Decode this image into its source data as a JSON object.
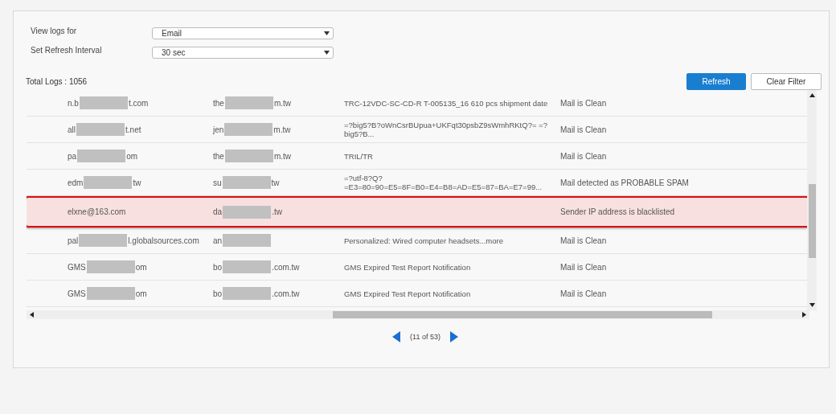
{
  "filters": [
    {
      "label": "View logs for",
      "value": "Email"
    },
    {
      "label": "Set Refresh Interval",
      "value": "30 sec"
    }
  ],
  "total_logs": "Total Logs : 1056",
  "buttons": [
    {
      "label": "Refresh",
      "kind": "primary"
    },
    {
      "label": "Clear Filter",
      "kind": "secondary"
    }
  ],
  "table": {
    "rows": [
      {
        "selected": false,
        "from": {
          "kind": "redacted",
          "start": "n.b",
          "end": "t.com"
        },
        "to": {
          "kind": "redacted",
          "start": "the",
          "end": "m.tw"
        },
        "subject": "TRC-12VDC-SC-CD-R T-005135_16 610 pcs shipment date",
        "status": "Mail is Clean"
      },
      {
        "selected": false,
        "from": {
          "kind": "redacted",
          "start": "all",
          "end": "t.net"
        },
        "to": {
          "kind": "redacted",
          "start": "jen",
          "end": "m.tw"
        },
        "subject": "=?big5?B?oWnCsrBUpua+UKFqt30psbZ9sWmhRKtQ?= =?big5?B...",
        "status": "Mail is Clean"
      },
      {
        "selected": false,
        "from": {
          "kind": "redacted",
          "start": "pa",
          "end": "om"
        },
        "to": {
          "kind": "redacted",
          "start": "the",
          "end": "m.tw"
        },
        "subject": "TRIL/TR",
        "status": "Mail is Clean"
      },
      {
        "selected": false,
        "from": {
          "kind": "redacted",
          "start": "edm",
          "end": "tw"
        },
        "to": {
          "kind": "redacted",
          "start": "su",
          "end": "tw"
        },
        "subject": "=?utf-8?Q? =E3=80=90=E5=8F=B0=E4=B8=AD=E5=87=BA=E7=99...",
        "status": "Mail detected as PROBABLE SPAM"
      },
      {
        "selected": true,
        "from": {
          "kind": "plain",
          "start": "elxne@163.com"
        },
        "to": {
          "kind": "redacted",
          "start": "da",
          "end": ".tw"
        },
        "subject": "",
        "status": "Sender IP address is blacklisted"
      },
      {
        "selected": false,
        "from": {
          "kind": "redacted",
          "start": "pal",
          "end": "l.globalsources.com"
        },
        "to": {
          "kind": "redacted",
          "start": "an"
        },
        "subject": "Personalized: Wired computer headsets...more",
        "status": "Mail is Clean"
      },
      {
        "selected": false,
        "from": {
          "kind": "redacted",
          "start": "GMS",
          "end": "om"
        },
        "to": {
          "kind": "redacted",
          "start": "bo",
          "end": ".com.tw"
        },
        "subject": "GMS Expired Test Report Notification",
        "status": "Mail is Clean"
      },
      {
        "selected": false,
        "from": {
          "kind": "redacted",
          "start": "GMS",
          "end": "om"
        },
        "to": {
          "kind": "redacted",
          "start": "bo",
          "end": ".com.tw"
        },
        "subject": "GMS Expired Test Report Notification",
        "status": "Mail is Clean"
      }
    ]
  },
  "pagination": "(11 of 53)"
}
